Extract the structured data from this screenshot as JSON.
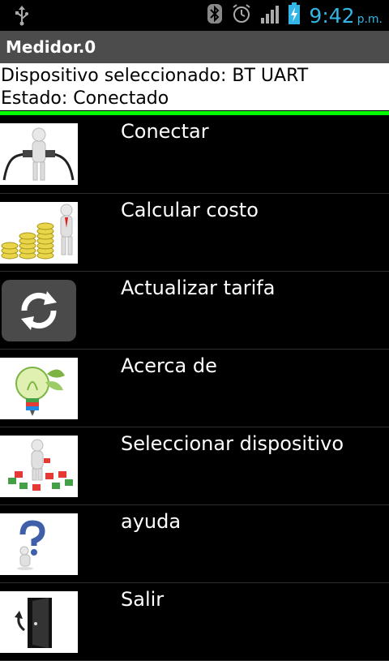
{
  "status_bar": {
    "time": "9:42",
    "ampm": "p.m.",
    "icons": [
      "usb-icon",
      "bluetooth-icon",
      "alarm-icon",
      "signal-icon",
      "battery-charging-icon"
    ],
    "accent_color": "#33b5e5"
  },
  "app": {
    "title": "Medidor.0"
  },
  "info": {
    "device_line": "Dispositivo seleccionado: BT UART",
    "state_line": "Estado: Conectado",
    "indicator_color": "#00ff00"
  },
  "menu": {
    "items": [
      {
        "label": "Conectar",
        "icon": "plug-connect-icon"
      },
      {
        "label": "Calcular costo",
        "icon": "coins-cost-icon"
      },
      {
        "label": "Actualizar tarifa",
        "icon": "refresh-icon"
      },
      {
        "label": "Acerca de",
        "icon": "eco-bulb-icon"
      },
      {
        "label": "Seleccionar dispositivo",
        "icon": "puzzle-select-icon"
      },
      {
        "label": "ayuda",
        "icon": "help-question-icon"
      },
      {
        "label": "Salir",
        "icon": "exit-door-icon"
      }
    ]
  }
}
